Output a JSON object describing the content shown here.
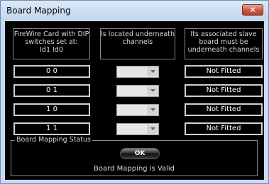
{
  "window": {
    "title": "Board Mapping",
    "close_label": "✕"
  },
  "headers": {
    "dip": "FireWire Card with DIP switches set at:\nId1  Id0",
    "channels": "Is located underneath channels",
    "slave": "Its associated slave board must be underneath channels"
  },
  "rows": [
    {
      "dip": "0 0",
      "channel": "",
      "slave": "Not Fitted"
    },
    {
      "dip": "0 1",
      "channel": "",
      "slave": "Not Fitted"
    },
    {
      "dip": "1 0",
      "channel": "",
      "slave": "Not Fitted"
    },
    {
      "dip": "1 1",
      "channel": "",
      "slave": "Not Fitted"
    }
  ],
  "status_group": {
    "label": "Board Mapping Status",
    "ok_label": "OK",
    "message": "Board Mapping is Valid"
  },
  "colors": {
    "title_bar": "#c9dbef",
    "client_bg": "#000000",
    "close_button": "#c65a48"
  },
  "icons": {
    "combo_arrow": "chevron-down-icon",
    "close": "close-icon"
  }
}
